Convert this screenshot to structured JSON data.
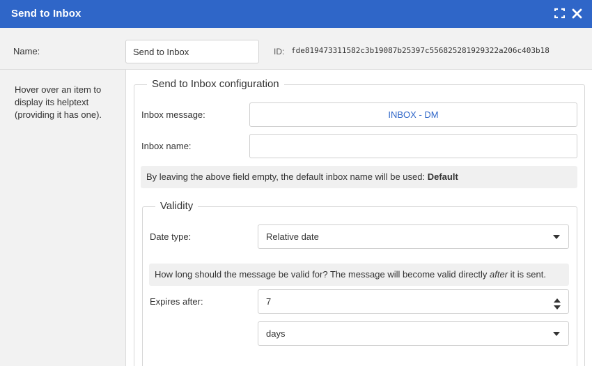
{
  "window": {
    "title": "Send to Inbox",
    "icons": [
      "fullscreen-icon",
      "close-icon"
    ],
    "accent_color": "#2f66c8"
  },
  "node": {
    "name_label": "Name:",
    "name_value": "Send to Inbox",
    "id_label": "ID:",
    "id_value": "fde819473311582c3b19087b25397c556825281929322a206c403b18"
  },
  "help": {
    "text": "Hover over an item to display its helptext (providing it has one)."
  },
  "config": {
    "legend": "Send to Inbox configuration",
    "inbox_message_label": "Inbox message:",
    "inbox_message_value": "INBOX - DM",
    "inbox_name_label": "Inbox name:",
    "inbox_name_value": "",
    "default_note_prefix": "By leaving the above field empty, the default inbox name will be used: ",
    "default_note_value": "Default"
  },
  "validity": {
    "legend": "Validity",
    "date_type_label": "Date type:",
    "date_type_value": "Relative date",
    "note_before": "How long should the message be valid for? The message will become valid directly ",
    "note_em": "after",
    "note_after": " it is sent.",
    "expires_label": "Expires after:",
    "expires_value": "7",
    "unit_value": "days"
  }
}
